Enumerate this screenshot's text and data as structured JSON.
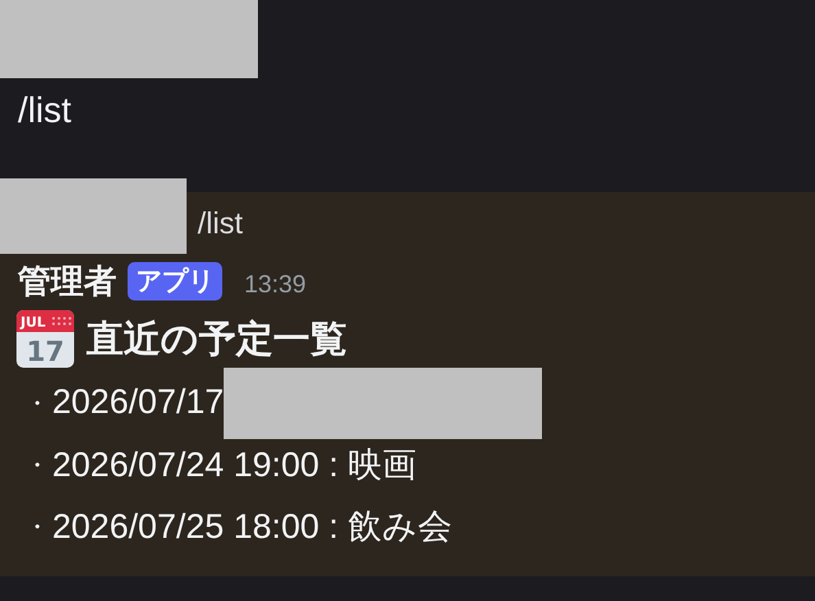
{
  "sent_command": "/list",
  "reply": {
    "command": "/list",
    "author": "管理者",
    "badge": "アプリ",
    "time": "13:39",
    "calendar_icon": {
      "month": "JUL",
      "day": "17"
    },
    "heading": "直近の予定一覧",
    "items": [
      {
        "bullet": "・",
        "text": "2026/07/17",
        "redacted": true
      },
      {
        "bullet": "・",
        "text": "2026/07/24 19:00 : 映画",
        "redacted": false
      },
      {
        "bullet": "・",
        "text": "2026/07/25 18:00 : 飲み会",
        "redacted": false
      }
    ]
  }
}
